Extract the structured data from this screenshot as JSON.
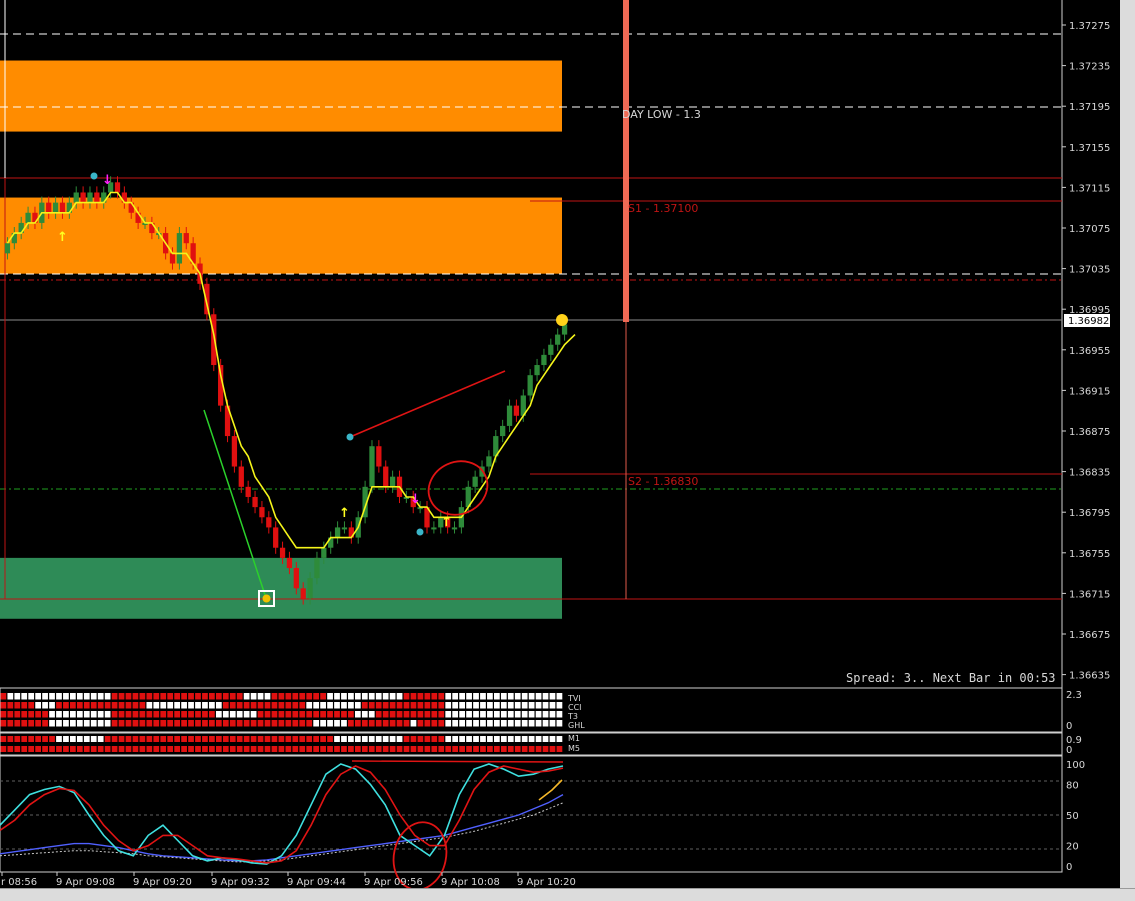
{
  "colors": {
    "background": "#000000",
    "bull_candle": "#2e8b3a",
    "bear_candle": "#e01010",
    "ma_line": "#f5f51a",
    "zone_supply": "#ff8c00",
    "zone_demand": "#2e8b57",
    "level_red": "#c01414",
    "axis_text": "#d8d8d8",
    "stoch_main": "#3fe0e0",
    "stoch_signal": "#e01414"
  },
  "price_axis": {
    "labels": [
      "1.37275",
      "1.37235",
      "1.37195",
      "1.37155",
      "1.37115",
      "1.37075",
      "1.37035",
      "1.36995",
      "1.36955",
      "1.36915",
      "1.36875",
      "1.36835",
      "1.36795",
      "1.36755",
      "1.36715",
      "1.36675",
      "1.36635"
    ],
    "current_price": "1.36982"
  },
  "levels": {
    "day_low": "DAY LOW - 1.3",
    "s1": "S1 - 1.37100",
    "s2": "S2 - 1.36830"
  },
  "info": {
    "spread": "Spread: 3.. Next Bar in 00:53"
  },
  "heatmap": {
    "rows": [
      "TVI",
      "CCI",
      "T3",
      "GHL"
    ],
    "scale_top": "2.3",
    "scale_bottom": "0"
  },
  "mtf": {
    "rows": [
      "M1",
      "M5"
    ],
    "scale_top": "0.9",
    "scale_bottom": "0"
  },
  "stoch_axis": {
    "labels": [
      "100",
      "80",
      "50",
      "20",
      "0"
    ]
  },
  "time_axis": {
    "labels": [
      "r 08:56",
      "9 Apr 09:08",
      "9 Apr 09:20",
      "9 Apr 09:32",
      "9 Apr 09:44",
      "9 Apr 09:56",
      "9 Apr 10:08",
      "9 Apr 10:20"
    ]
  },
  "chart_data": {
    "type": "candlestick",
    "symbol_timeframe": "M1",
    "ylim": [
      1.3663,
      1.3728
    ],
    "candles_close": [
      1.3706,
      1.3707,
      1.3708,
      1.3709,
      1.3708,
      1.371,
      1.3709,
      1.371,
      1.3709,
      1.371,
      1.3711,
      1.371,
      1.3711,
      1.371,
      1.3711,
      1.3712,
      1.3711,
      1.371,
      1.3709,
      1.3708,
      1.3708,
      1.3707,
      1.3707,
      1.3705,
      1.3704,
      1.3707,
      1.3706,
      1.3704,
      1.3702,
      1.3699,
      1.3694,
      1.369,
      1.3687,
      1.3684,
      1.3682,
      1.3681,
      1.368,
      1.3679,
      1.3678,
      1.3676,
      1.3675,
      1.3674,
      1.3672,
      1.3671,
      1.3673,
      1.3675,
      1.3676,
      1.3677,
      1.3678,
      1.3678,
      1.3677,
      1.3679,
      1.3682,
      1.3686,
      1.3684,
      1.3682,
      1.3683,
      1.3681,
      1.3681,
      1.368,
      1.368,
      1.3678,
      1.3678,
      1.3679,
      1.3678,
      1.3678,
      1.368,
      1.3682,
      1.3683,
      1.3684,
      1.3685,
      1.3687,
      1.3688,
      1.369,
      1.3689,
      1.3691,
      1.3693,
      1.3694,
      1.3695,
      1.3696,
      1.3697,
      1.3698
    ],
    "ma_close": [
      1.3706,
      1.3707,
      1.3707,
      1.3708,
      1.3708,
      1.3709,
      1.3709,
      1.3709,
      1.3709,
      1.3709,
      1.371,
      1.371,
      1.371,
      1.371,
      1.371,
      1.3711,
      1.3711,
      1.371,
      1.371,
      1.3709,
      1.3708,
      1.3708,
      1.3707,
      1.3706,
      1.3705,
      1.3705,
      1.3705,
      1.3704,
      1.3703,
      1.37,
      1.3697,
      1.3693,
      1.369,
      1.3688,
      1.3686,
      1.3685,
      1.3683,
      1.3682,
      1.3681,
      1.3679,
      1.3678,
      1.3677,
      1.3676,
      1.3676,
      1.3676,
      1.3676,
      1.3676,
      1.3677,
      1.3677,
      1.3677,
      1.3677,
      1.3678,
      1.368,
      1.3682,
      1.3682,
      1.3682,
      1.3682,
      1.3682,
      1.3681,
      1.3681,
      1.368,
      1.368,
      1.3679,
      1.3679,
      1.3679,
      1.3679,
      1.3679,
      1.368,
      1.3681,
      1.3682,
      1.3683,
      1.3685,
      1.3686,
      1.3687,
      1.3688,
      1.3689,
      1.369,
      1.3692,
      1.3693,
      1.3694,
      1.3695,
      1.3696
    ],
    "zones": [
      {
        "name": "supply-zone-upper",
        "from": 1.3717,
        "to": 1.3724
      },
      {
        "name": "supply-zone-lower",
        "from": 1.3703,
        "to": 1.37105
      },
      {
        "name": "demand-zone",
        "from": 1.3669,
        "to": 1.3675
      }
    ],
    "stochastic": {
      "ylim": [
        0,
        100
      ],
      "main": [
        40,
        55,
        70,
        75,
        78,
        72,
        50,
        30,
        15,
        10,
        30,
        40,
        25,
        10,
        5,
        8,
        6,
        3,
        2,
        10,
        30,
        60,
        90,
        100,
        95,
        80,
        60,
        30,
        20,
        10,
        30,
        70,
        95,
        100,
        95,
        88,
        90,
        95,
        98
      ],
      "signal": [
        35,
        45,
        60,
        70,
        76,
        74,
        60,
        40,
        25,
        15,
        20,
        30,
        30,
        20,
        10,
        8,
        7,
        5,
        3,
        5,
        15,
        40,
        70,
        90,
        98,
        92,
        75,
        50,
        30,
        20,
        20,
        45,
        75,
        92,
        98,
        95,
        92,
        93,
        96
      ]
    }
  }
}
